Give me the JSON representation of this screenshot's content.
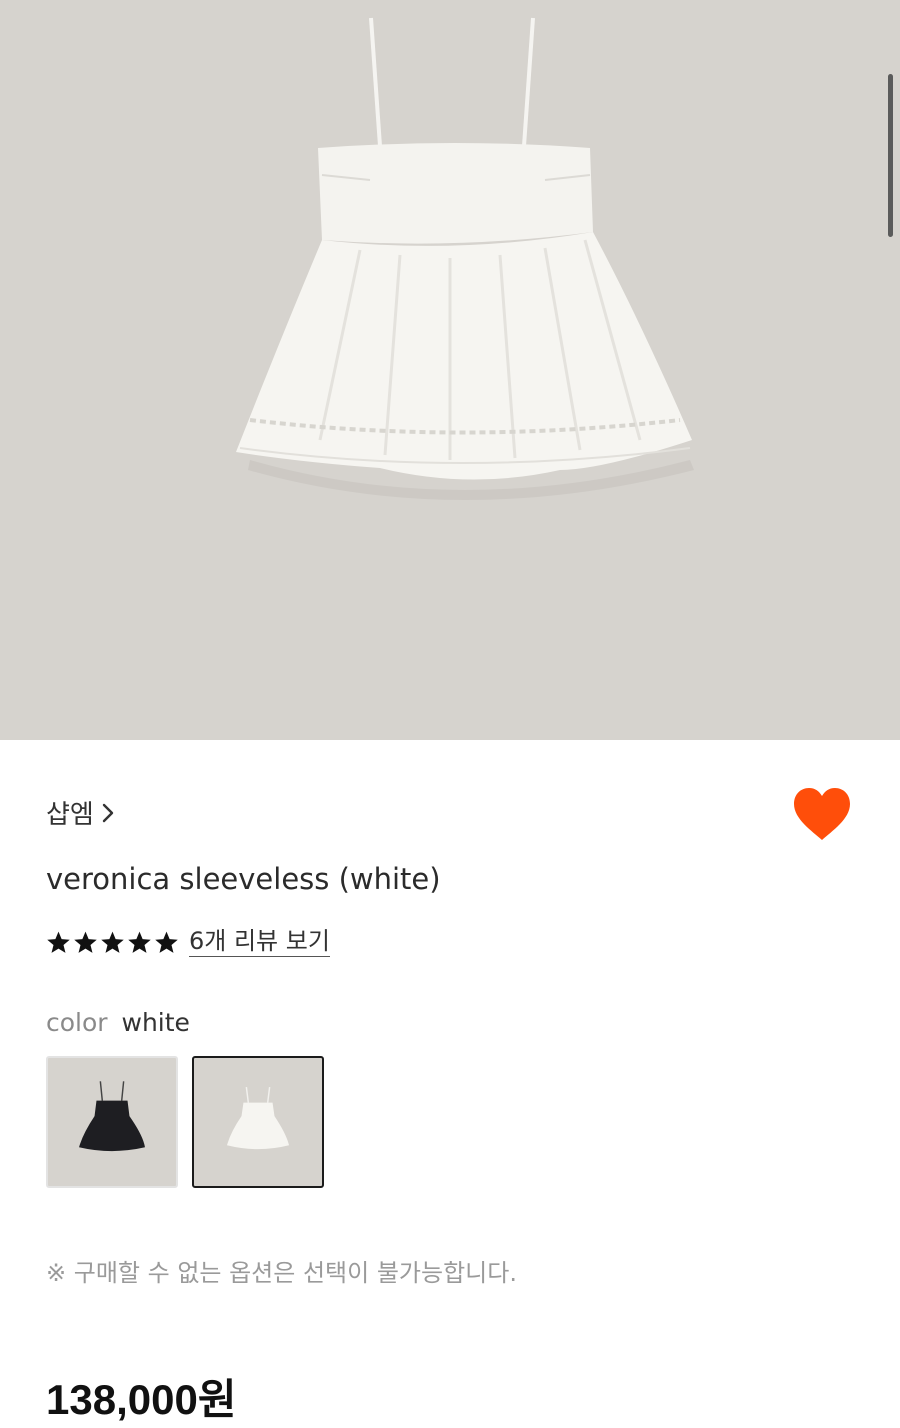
{
  "product": {
    "brand": "샵엠",
    "title": "veronica sleeveless (white)",
    "rating_stars": 5,
    "reviews_link": "6개 리뷰 보기",
    "color_label": "color",
    "color_value": "white",
    "options": [
      {
        "name": "black",
        "selected": false
      },
      {
        "name": "white",
        "selected": true
      }
    ],
    "notice": "※ 구매할 수 없는 옵션은 선택이 불가능합니다.",
    "price": "138,000원",
    "favorited": true
  },
  "colors": {
    "hero_background": "#d6d3ce",
    "heart": "#ff4e0a",
    "text": "#222222",
    "muted": "#8a8a8a"
  },
  "icons": {
    "brand_chevron": "chevron-right-icon",
    "favorite": "heart-icon",
    "rating": "star-icon"
  }
}
